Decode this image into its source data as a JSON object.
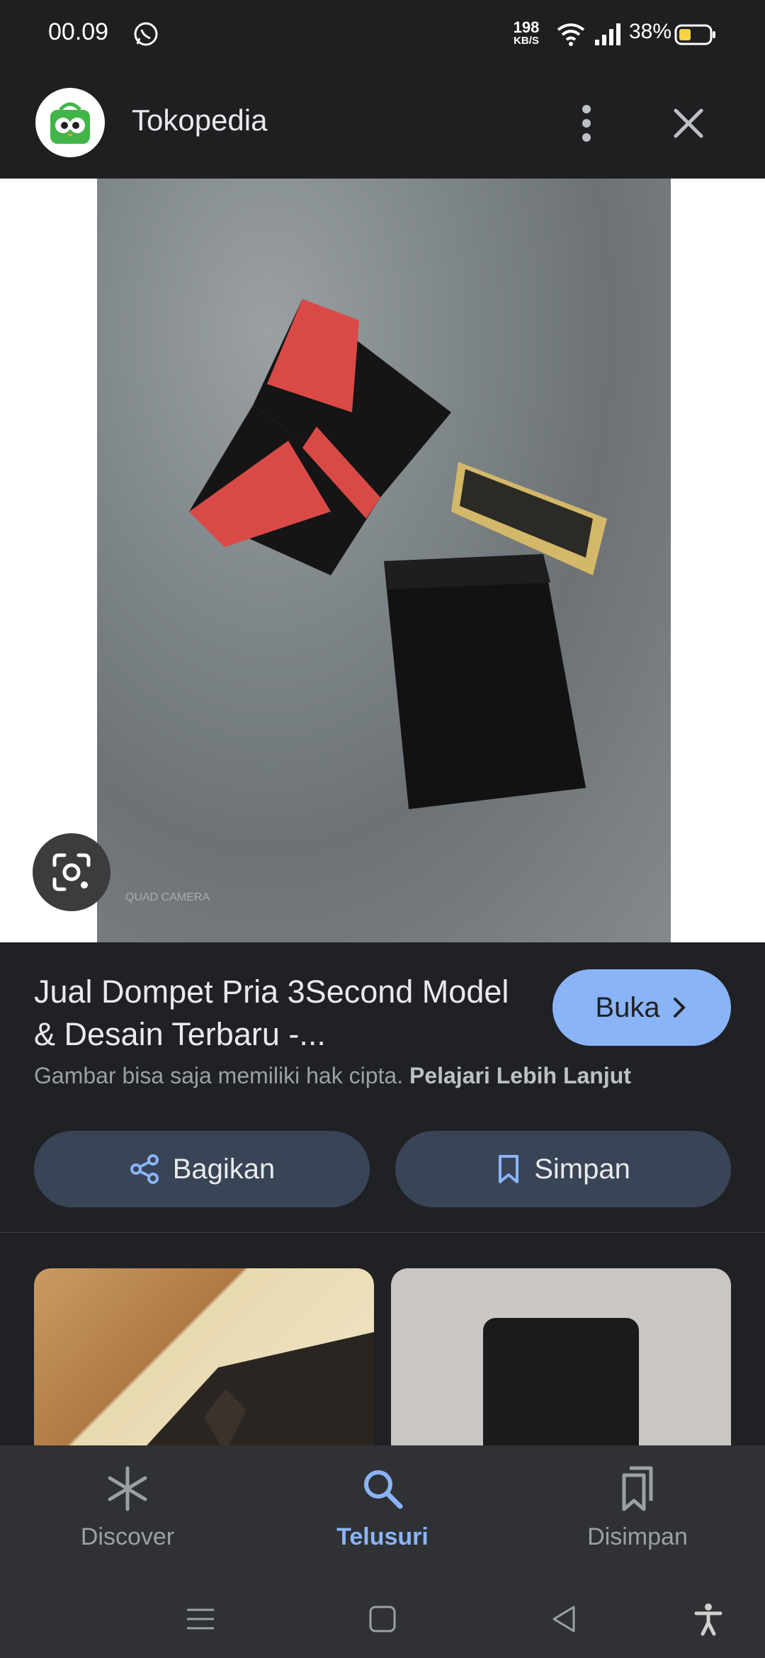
{
  "status_bar": {
    "time": "00.09",
    "net_speed_value": "198",
    "net_speed_unit": "KB/S",
    "battery_percent": "38%"
  },
  "app_bar": {
    "title": "Tokopedia"
  },
  "main_image": {
    "watermark": "QUAD CAMERA"
  },
  "info": {
    "title": "Jual Dompet Pria 3Second Model & Desain Terbaru -...",
    "open_label": "Buka",
    "copyright_text": "Gambar bisa saja memiliki hak cipta.",
    "learn_more": "Pelajari Lebih Lanjut",
    "share_label": "Bagikan",
    "save_label": "Simpan"
  },
  "bottom_nav": {
    "items": [
      {
        "label": "Discover",
        "icon": "asterisk-icon",
        "active": false
      },
      {
        "label": "Telusuri",
        "icon": "search-icon",
        "active": true
      },
      {
        "label": "Disimpan",
        "icon": "bookmarks-icon",
        "active": false
      }
    ]
  },
  "colors": {
    "accent": "#8ab4f8",
    "background": "#202124",
    "button_bg": "#394457"
  }
}
